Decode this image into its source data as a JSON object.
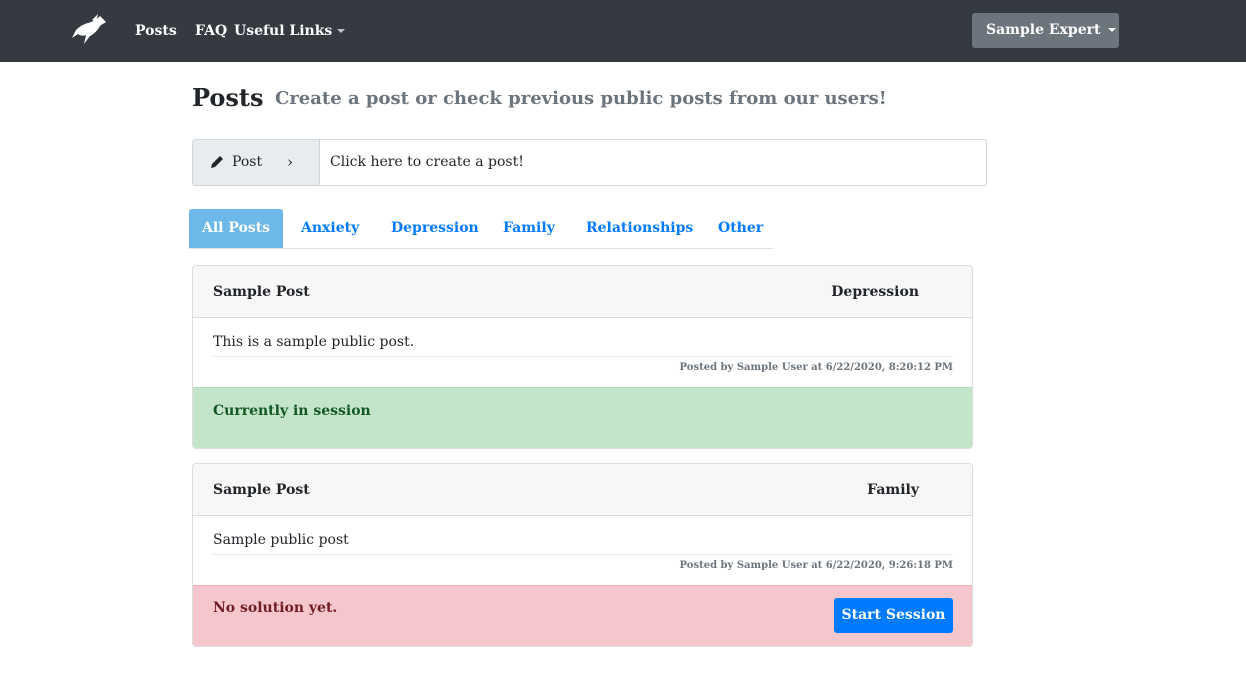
{
  "nav": {
    "logo_icon": "pegasus-logo-icon",
    "links": [
      "Posts",
      "FAQ",
      "Useful Links"
    ],
    "user_label": "Sample Expert"
  },
  "header": {
    "title": "Posts",
    "subtitle": "Create a post or check previous public posts from our users!"
  },
  "post_box": {
    "button_label": "Post",
    "chevron": "›",
    "placeholder": "Click here to create a post!"
  },
  "tabs": [
    "All Posts",
    "Anxiety",
    "Depression",
    "Family",
    "Relationships",
    "Other"
  ],
  "posts": [
    {
      "title": "Sample Post",
      "category": "Depression",
      "body": "This is a sample public post.",
      "meta": "Posted by Sample User at 6/22/2020, 8:20:12 PM",
      "status": "Currently in session"
    },
    {
      "title": "Sample Post",
      "category": "Family",
      "body": "Sample public post",
      "meta": "Posted by Sample User at 6/22/2020, 9:26:18 PM",
      "status": "No solution yet.",
      "action_label": "Start Session"
    }
  ],
  "colors": {
    "navbar": "#343a40",
    "active_tab": "#6cb8e8",
    "link": "#007bff",
    "success_bg": "#c3e6cb",
    "danger_bg": "#f5c6cb"
  }
}
